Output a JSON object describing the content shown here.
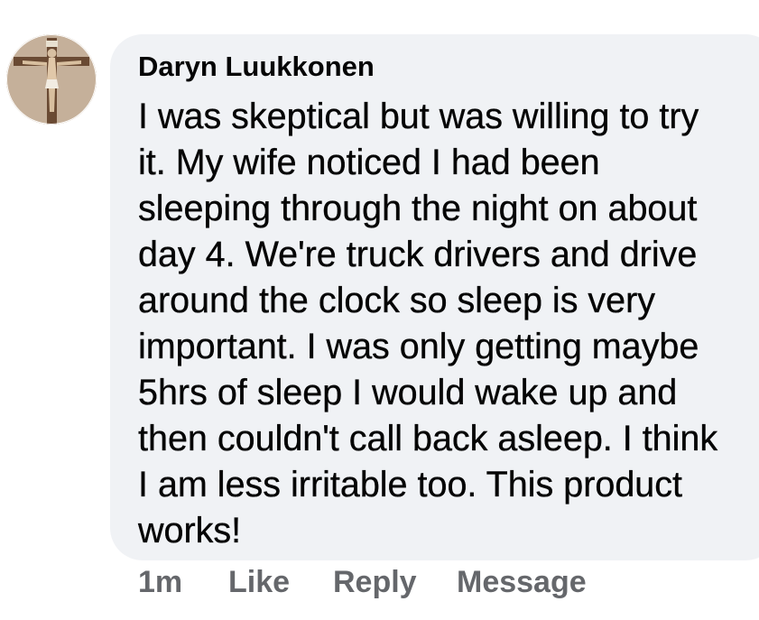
{
  "comment": {
    "author": "Daryn Luukkonen",
    "avatar_icon": "crucifix-avatar-icon",
    "body_lines": [
      "I was skeptical but was willing to try",
      "it.  My wife noticed I had been",
      "sleeping through the night on about",
      "day 4. We're truck drivers and drive",
      "around the clock so sleep is very",
      "important. I was only getting maybe",
      "5hrs of sleep I would wake up and",
      "then couldn't call back asleep. I think",
      "I am less irritable too. This product",
      "works!"
    ]
  },
  "actions": {
    "time": "1m",
    "like": "Like",
    "reply": "Reply",
    "message": "Message"
  },
  "colors": {
    "bubble": "#f0f2f5",
    "text": "#050505",
    "secondary": "#65676b"
  }
}
